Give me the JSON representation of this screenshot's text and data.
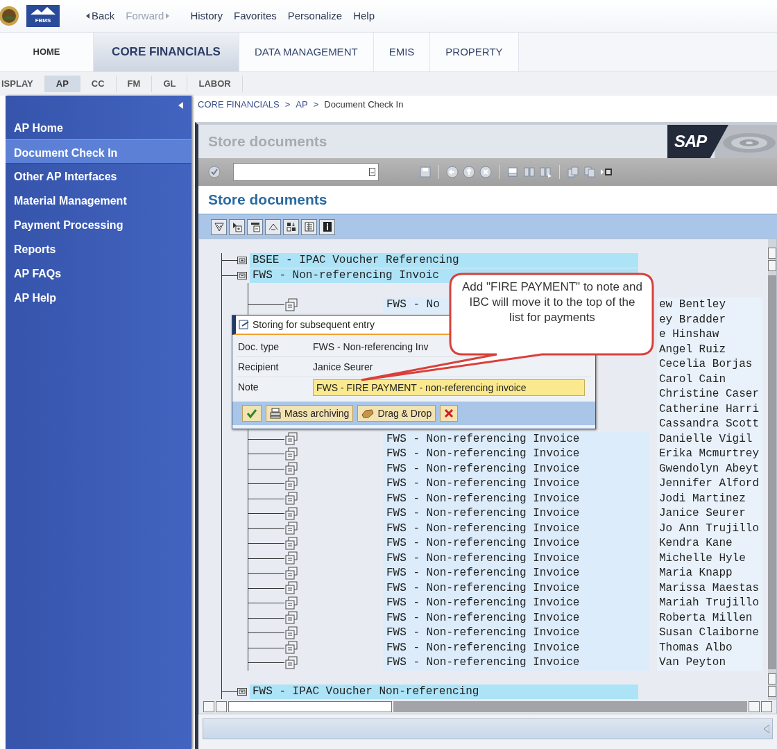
{
  "logo": {
    "caption": "FBMS"
  },
  "nav": [
    {
      "label": "Back",
      "kind": "back",
      "disabled": false
    },
    {
      "label": "Forward",
      "kind": "forward",
      "disabled": true
    },
    {
      "label": "History",
      "kind": "link",
      "disabled": false
    },
    {
      "label": "Favorites",
      "kind": "link",
      "disabled": false
    },
    {
      "label": "Personalize",
      "kind": "link",
      "disabled": false
    },
    {
      "label": "Help",
      "kind": "link",
      "disabled": false
    }
  ],
  "tabs": [
    {
      "label": "HOME",
      "selected": false
    },
    {
      "label": "CORE FINANCIALS",
      "selected": true
    },
    {
      "label": "DATA MANAGEMENT",
      "selected": false
    },
    {
      "label": "EMIS",
      "selected": false
    },
    {
      "label": "PROPERTY",
      "selected": false
    }
  ],
  "subtabs": [
    {
      "label": "ISPLAY",
      "selected": false
    },
    {
      "label": "AP",
      "selected": true
    },
    {
      "label": "CC",
      "selected": false
    },
    {
      "label": "FM",
      "selected": false
    },
    {
      "label": "GL",
      "selected": false
    },
    {
      "label": "LABOR",
      "selected": false
    }
  ],
  "sidebar": {
    "items": [
      {
        "label": "AP Home",
        "selected": false
      },
      {
        "label": "Document Check In",
        "selected": true
      },
      {
        "label": "Other AP Interfaces",
        "selected": false
      },
      {
        "label": "Material Management",
        "selected": false
      },
      {
        "label": "Payment Processing",
        "selected": false
      },
      {
        "label": "Reports",
        "selected": false
      },
      {
        "label": "AP FAQs",
        "selected": false
      },
      {
        "label": "AP Help",
        "selected": false
      }
    ]
  },
  "breadcrumb": {
    "items": [
      "CORE FINANCIALS",
      "AP",
      "Document Check In"
    ],
    "separator": ">"
  },
  "sap_window": {
    "title": "Store documents",
    "logo": "SAP"
  },
  "screen": {
    "title": "Store documents"
  },
  "tree": {
    "nodes": [
      {
        "label": "BSEE - IPAC Voucher Referencing",
        "expanded": false
      },
      {
        "label": "FWS - Non-referencing Invoic",
        "expanded": true,
        "children": [
          {
            "doc_type": "FWS - No",
            "name": "ew Bentley"
          },
          {
            "name": "ey Bradder"
          },
          {
            "name": "e Hinshaw"
          },
          {
            "name": "Angel Ruiz"
          },
          {
            "name": "Cecelia Borjas"
          },
          {
            "name": "Carol Cain"
          },
          {
            "name": "Christine Caser"
          },
          {
            "name": "Catherine Harri"
          },
          {
            "name": "Cassandra Scott"
          },
          {
            "doc_type": "FWS - Non-referencing Invoice",
            "name": "Danielle Vigil"
          },
          {
            "doc_type": "FWS - Non-referencing Invoice",
            "name": "Erika Mcmurtrey"
          },
          {
            "doc_type": "FWS - Non-referencing Invoice",
            "name": "Gwendolyn Abeyt"
          },
          {
            "doc_type": "FWS - Non-referencing Invoice",
            "name": "Jennifer Alford"
          },
          {
            "doc_type": "FWS - Non-referencing Invoice",
            "name": "Jodi Martinez"
          },
          {
            "doc_type": "FWS - Non-referencing Invoice",
            "name": "Janice Seurer"
          },
          {
            "doc_type": "FWS - Non-referencing Invoice",
            "name": "Jo Ann Trujillo"
          },
          {
            "doc_type": "FWS - Non-referencing Invoice",
            "name": "Kendra Kane"
          },
          {
            "doc_type": "FWS - Non-referencing Invoice",
            "name": "Michelle Hyle"
          },
          {
            "doc_type": "FWS - Non-referencing Invoice",
            "name": "Maria Knapp"
          },
          {
            "doc_type": "FWS - Non-referencing Invoice",
            "name": "Marissa Maestas"
          },
          {
            "doc_type": "FWS - Non-referencing Invoice",
            "name": "Mariah Trujillo"
          },
          {
            "doc_type": "FWS - Non-referencing Invoice",
            "name": "Roberta Millen"
          },
          {
            "doc_type": "FWS - Non-referencing Invoice",
            "name": "Susan Claiborne"
          },
          {
            "doc_type": "FWS - Non-referencing Invoice",
            "name": "Thomas Albo"
          },
          {
            "doc_type": "FWS - Non-referencing Invoice",
            "name": "Van Peyton"
          }
        ]
      },
      {
        "label": "FWS - IPAC Voucher Non-referencing",
        "expanded": false
      }
    ]
  },
  "dialog": {
    "title": "Storing for subsequent entry",
    "fields": [
      {
        "label": "Doc. type",
        "value": "FWS - Non-referencing Inv",
        "kind": "text"
      },
      {
        "label": "Recipient",
        "value": "Janice Seurer",
        "kind": "text"
      },
      {
        "label": "Note",
        "value": "FWS - FIRE PAYMENT - non-referencing invoice",
        "kind": "input"
      }
    ],
    "buttons": [
      {
        "kind": "ok"
      },
      {
        "kind": "archive",
        "label": "Mass archiving"
      },
      {
        "kind": "drag",
        "label": "Drag & Drop"
      },
      {
        "kind": "cancel"
      }
    ]
  },
  "callout": {
    "text": "Add \"FIRE PAYMENT\" to note and IBC will move it to the top of the list for payments"
  }
}
